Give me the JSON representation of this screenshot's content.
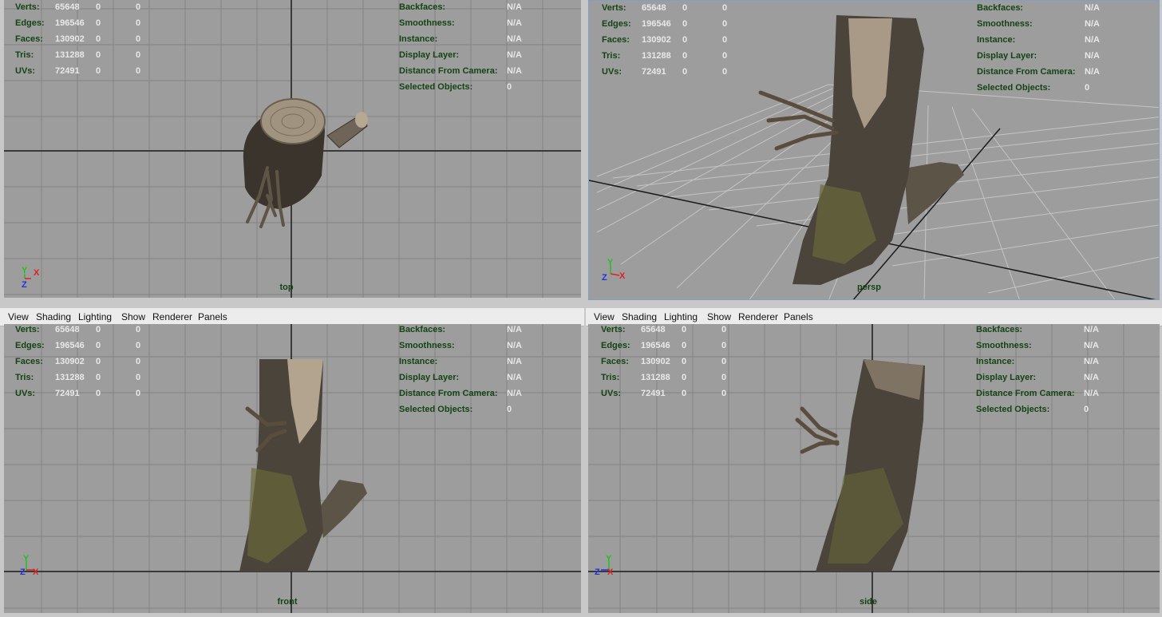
{
  "hud": {
    "stats": [
      {
        "label": "Verts:",
        "v1": "65648",
        "v2": "0",
        "v3": "0"
      },
      {
        "label": "Edges:",
        "v1": "196546",
        "v2": "0",
        "v3": "0"
      },
      {
        "label": "Faces:",
        "v1": "130902",
        "v2": "0",
        "v3": "0"
      },
      {
        "label": "Tris:",
        "v1": "131288",
        "v2": "0",
        "v3": "0"
      },
      {
        "label": "UVs:",
        "v1": "72491",
        "v2": "0",
        "v3": "0"
      }
    ],
    "info": [
      {
        "label": "Backfaces:",
        "value": "N/A"
      },
      {
        "label": "Smoothness:",
        "value": "N/A"
      },
      {
        "label": "Instance:",
        "value": "N/A"
      },
      {
        "label": "Display Layer:",
        "value": "N/A"
      },
      {
        "label": "Distance From Camera:",
        "value": "N/A"
      },
      {
        "label": "Selected Objects:",
        "value": "0"
      }
    ]
  },
  "menu": [
    "View",
    "Shading",
    "Lighting",
    "Show",
    "Renderer",
    "Panels"
  ],
  "viewports": [
    {
      "id": "top",
      "camera": "top",
      "axes": [
        "Y",
        "X",
        "Z"
      ]
    },
    {
      "id": "persp",
      "camera": "persp",
      "axes": [
        "Y",
        "Z",
        "X"
      ]
    },
    {
      "id": "front",
      "camera": "front",
      "axes": [
        "Y",
        "Z",
        "X"
      ]
    },
    {
      "id": "side",
      "camera": "side",
      "axes": [
        "Y",
        "Z",
        "X"
      ]
    }
  ],
  "colors": {
    "viewport_bg": "#9d9d9d",
    "grid": "#848484",
    "axis_line": "#1a1a1a",
    "hud_label": "#144414",
    "hud_value": "#e8e8e8",
    "x_axis": "#e02020",
    "y_axis": "#20c020",
    "z_axis": "#2030e0"
  }
}
